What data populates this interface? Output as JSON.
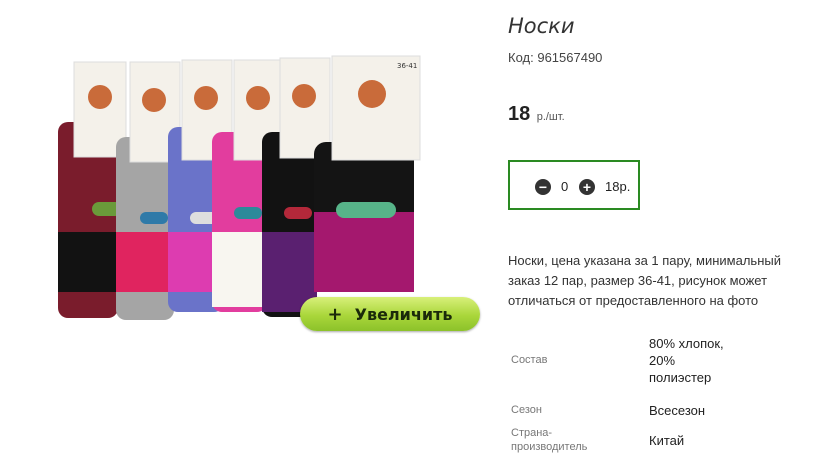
{
  "product": {
    "title": "Носки",
    "code_label": "Код:",
    "code_value": "961567490",
    "price_value": "18",
    "price_unit": "р./шт."
  },
  "zoom_button": {
    "icon": "plus",
    "label": "Увеличить"
  },
  "quantity": {
    "minus_icon": "minus-circle-icon",
    "plus_icon": "plus-circle-icon",
    "value": "0",
    "total": "18р.",
    "box_color": "#2a8a22"
  },
  "description": "Носки, цена указана за 1 пару, минимальный заказ 12 пар, размер 36-41, рисунок может отличаться от предоставленного на фото",
  "properties": [
    {
      "label": "Состав",
      "value": "80% хлопок, 20% полиэстер"
    },
    {
      "label": "Сезон",
      "value": "Всесезон"
    },
    {
      "label": "Страна-производитель",
      "value": "Китай"
    }
  ],
  "package_size": "36-41"
}
